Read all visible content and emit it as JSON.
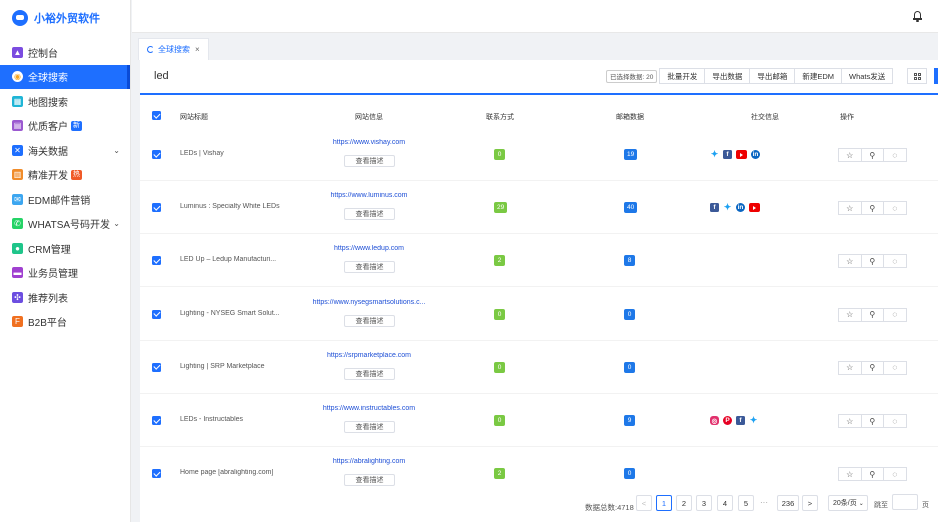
{
  "brand": {
    "title": "小裕外贸软件"
  },
  "sidebar": {
    "items": [
      {
        "label": "控制台",
        "icon": "chart-icon",
        "color": "#7b4ce0"
      },
      {
        "label": "全球搜索",
        "icon": "globe-icon",
        "color": "#f5a623",
        "active": true
      },
      {
        "label": "地图搜索",
        "icon": "map-icon",
        "color": "#1fb5d6"
      },
      {
        "label": "优质客户",
        "icon": "book-icon",
        "color": "#9b59d0",
        "badge": "新",
        "badge_color": "#1e6fff"
      },
      {
        "label": "海关数据",
        "icon": "compass-icon",
        "color": "#1e6fff",
        "arrow": "⌄"
      },
      {
        "label": "精准开发",
        "icon": "target-icon",
        "color": "#f08c2a",
        "badge": "热",
        "badge_color": "#f05a28"
      },
      {
        "label": "EDM邮件营销",
        "icon": "mail-icon",
        "color": "#3ca6f0"
      },
      {
        "label": "WHATSA号码开发",
        "icon": "whatsapp-icon",
        "color": "#25d366",
        "arrow": "⌄"
      },
      {
        "label": "CRM管理",
        "icon": "user-icon",
        "color": "#1fc58a"
      },
      {
        "label": "业务员管理",
        "icon": "briefcase-icon",
        "color": "#a040d0"
      },
      {
        "label": "推荐列表",
        "icon": "share-icon",
        "color": "#6c4ee0"
      },
      {
        "label": "B2B平台",
        "icon": "fa-logo-icon",
        "color": "#f07020"
      }
    ]
  },
  "tabs": [
    {
      "label": "全球搜索",
      "close": "×"
    }
  ],
  "search": {
    "keyword": "led"
  },
  "toolbar": {
    "selected_count": "已选择数据: 20",
    "buttons": [
      "批量开发",
      "导出数据",
      "导出邮箱",
      "新建EDM",
      "Whats发送"
    ]
  },
  "table": {
    "headers": {
      "title": "网站标题",
      "info": "网站信息",
      "contact": "联系方式",
      "email": "邮箱数据",
      "social": "社交信息",
      "ops": "操作"
    },
    "desc_label": "查看描述",
    "rows": [
      {
        "title": "LEDs | Vishay",
        "url": "https://www.vishay.com",
        "contact": "0",
        "email": "19",
        "socials": [
          "twitter",
          "facebook",
          "youtube",
          "linkedin"
        ]
      },
      {
        "title": "Luminus : Specialty White LEDs",
        "url": "https://www.luminus.com",
        "contact": "29",
        "email": "40",
        "socials": [
          "facebook",
          "twitter",
          "linkedin",
          "youtube"
        ]
      },
      {
        "title": "LED Up – Ledup Manufacturi...",
        "url": "https://www.ledup.com",
        "contact": "2",
        "email": "8",
        "socials": []
      },
      {
        "title": "Lighting - NYSEG Smart Solut...",
        "url": "https://www.nysegsmartsolutions.c...",
        "contact": "0",
        "email": "0",
        "socials": []
      },
      {
        "title": "Lighting | SRP Marketplace",
        "url": "https://srpmarketplace.com",
        "contact": "0",
        "email": "0",
        "socials": []
      },
      {
        "title": "LEDs - Instructables",
        "url": "https://www.instructables.com",
        "contact": "0",
        "email": "9",
        "socials": [
          "instagram",
          "pinterest",
          "facebook",
          "twitter"
        ]
      },
      {
        "title": "Home page [abralighting.com]",
        "url": "https://abralighting.com",
        "contact": "2",
        "email": "0",
        "socials": []
      }
    ]
  },
  "pagination": {
    "total": "数据总数:4718",
    "prev": "<",
    "pages": [
      "1",
      "2",
      "3",
      "4",
      "5"
    ],
    "ellipsis": "···",
    "last": "236",
    "next": ">",
    "page_size": "20条/页",
    "goto_label": "跳至",
    "page_unit": "页",
    "current": "1"
  }
}
